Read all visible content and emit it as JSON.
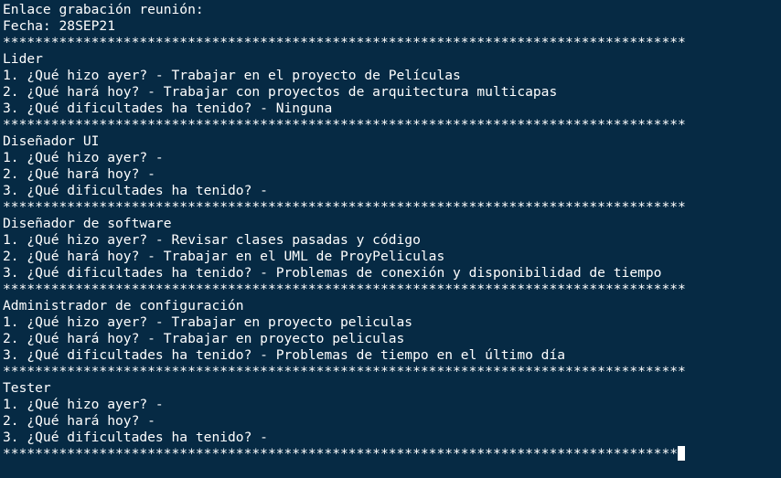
{
  "terminal": {
    "background": "#062a44",
    "foreground": "#ffffff",
    "header": {
      "title": "Enlace grabación reunión:",
      "date": "Fecha: 28SEP21"
    },
    "separator": "*************************************************************************************",
    "sections": [
      {
        "role": "Lider",
        "q1": "1. ¿Qué hizo ayer? - Trabajar en el proyecto de Películas",
        "q2": "2. ¿Qué hará hoy? - Trabajar con proyectos de arquitectura multicapas",
        "q3": "3. ¿Qué dificultades ha tenido? - Ninguna"
      },
      {
        "role": "Diseñador UI",
        "q1": "1. ¿Qué hizo ayer? -",
        "q2": "2. ¿Qué hará hoy? -",
        "q3": "3. ¿Qué dificultades ha tenido? -"
      },
      {
        "role": "Diseñador de software",
        "q1": "1. ¿Qué hizo ayer? - Revisar clases pasadas y código",
        "q2": "2. ¿Qué hará hoy? - Trabajar en el UML de ProyPeliculas",
        "q3": "3. ¿Qué dificultades ha tenido? - Problemas de conexión y disponibilidad de tiempo"
      },
      {
        "role": "Administrador de configuración",
        "q1": "1. ¿Qué hizo ayer? - Trabajar en proyecto peliculas",
        "q2": "2. ¿Qué hará hoy? - Trabajar en proyecto peliculas",
        "q3": "3. ¿Qué dificultades ha tenido? - Problemas de tiempo en el último día"
      },
      {
        "role": "Tester",
        "q1": "1. ¿Qué hizo ayer? -",
        "q2": "2. ¿Qué hará hoy? -",
        "q3": "3. ¿Qué dificultades ha tenido? -"
      }
    ],
    "last_separator": "************************************************************************************"
  }
}
